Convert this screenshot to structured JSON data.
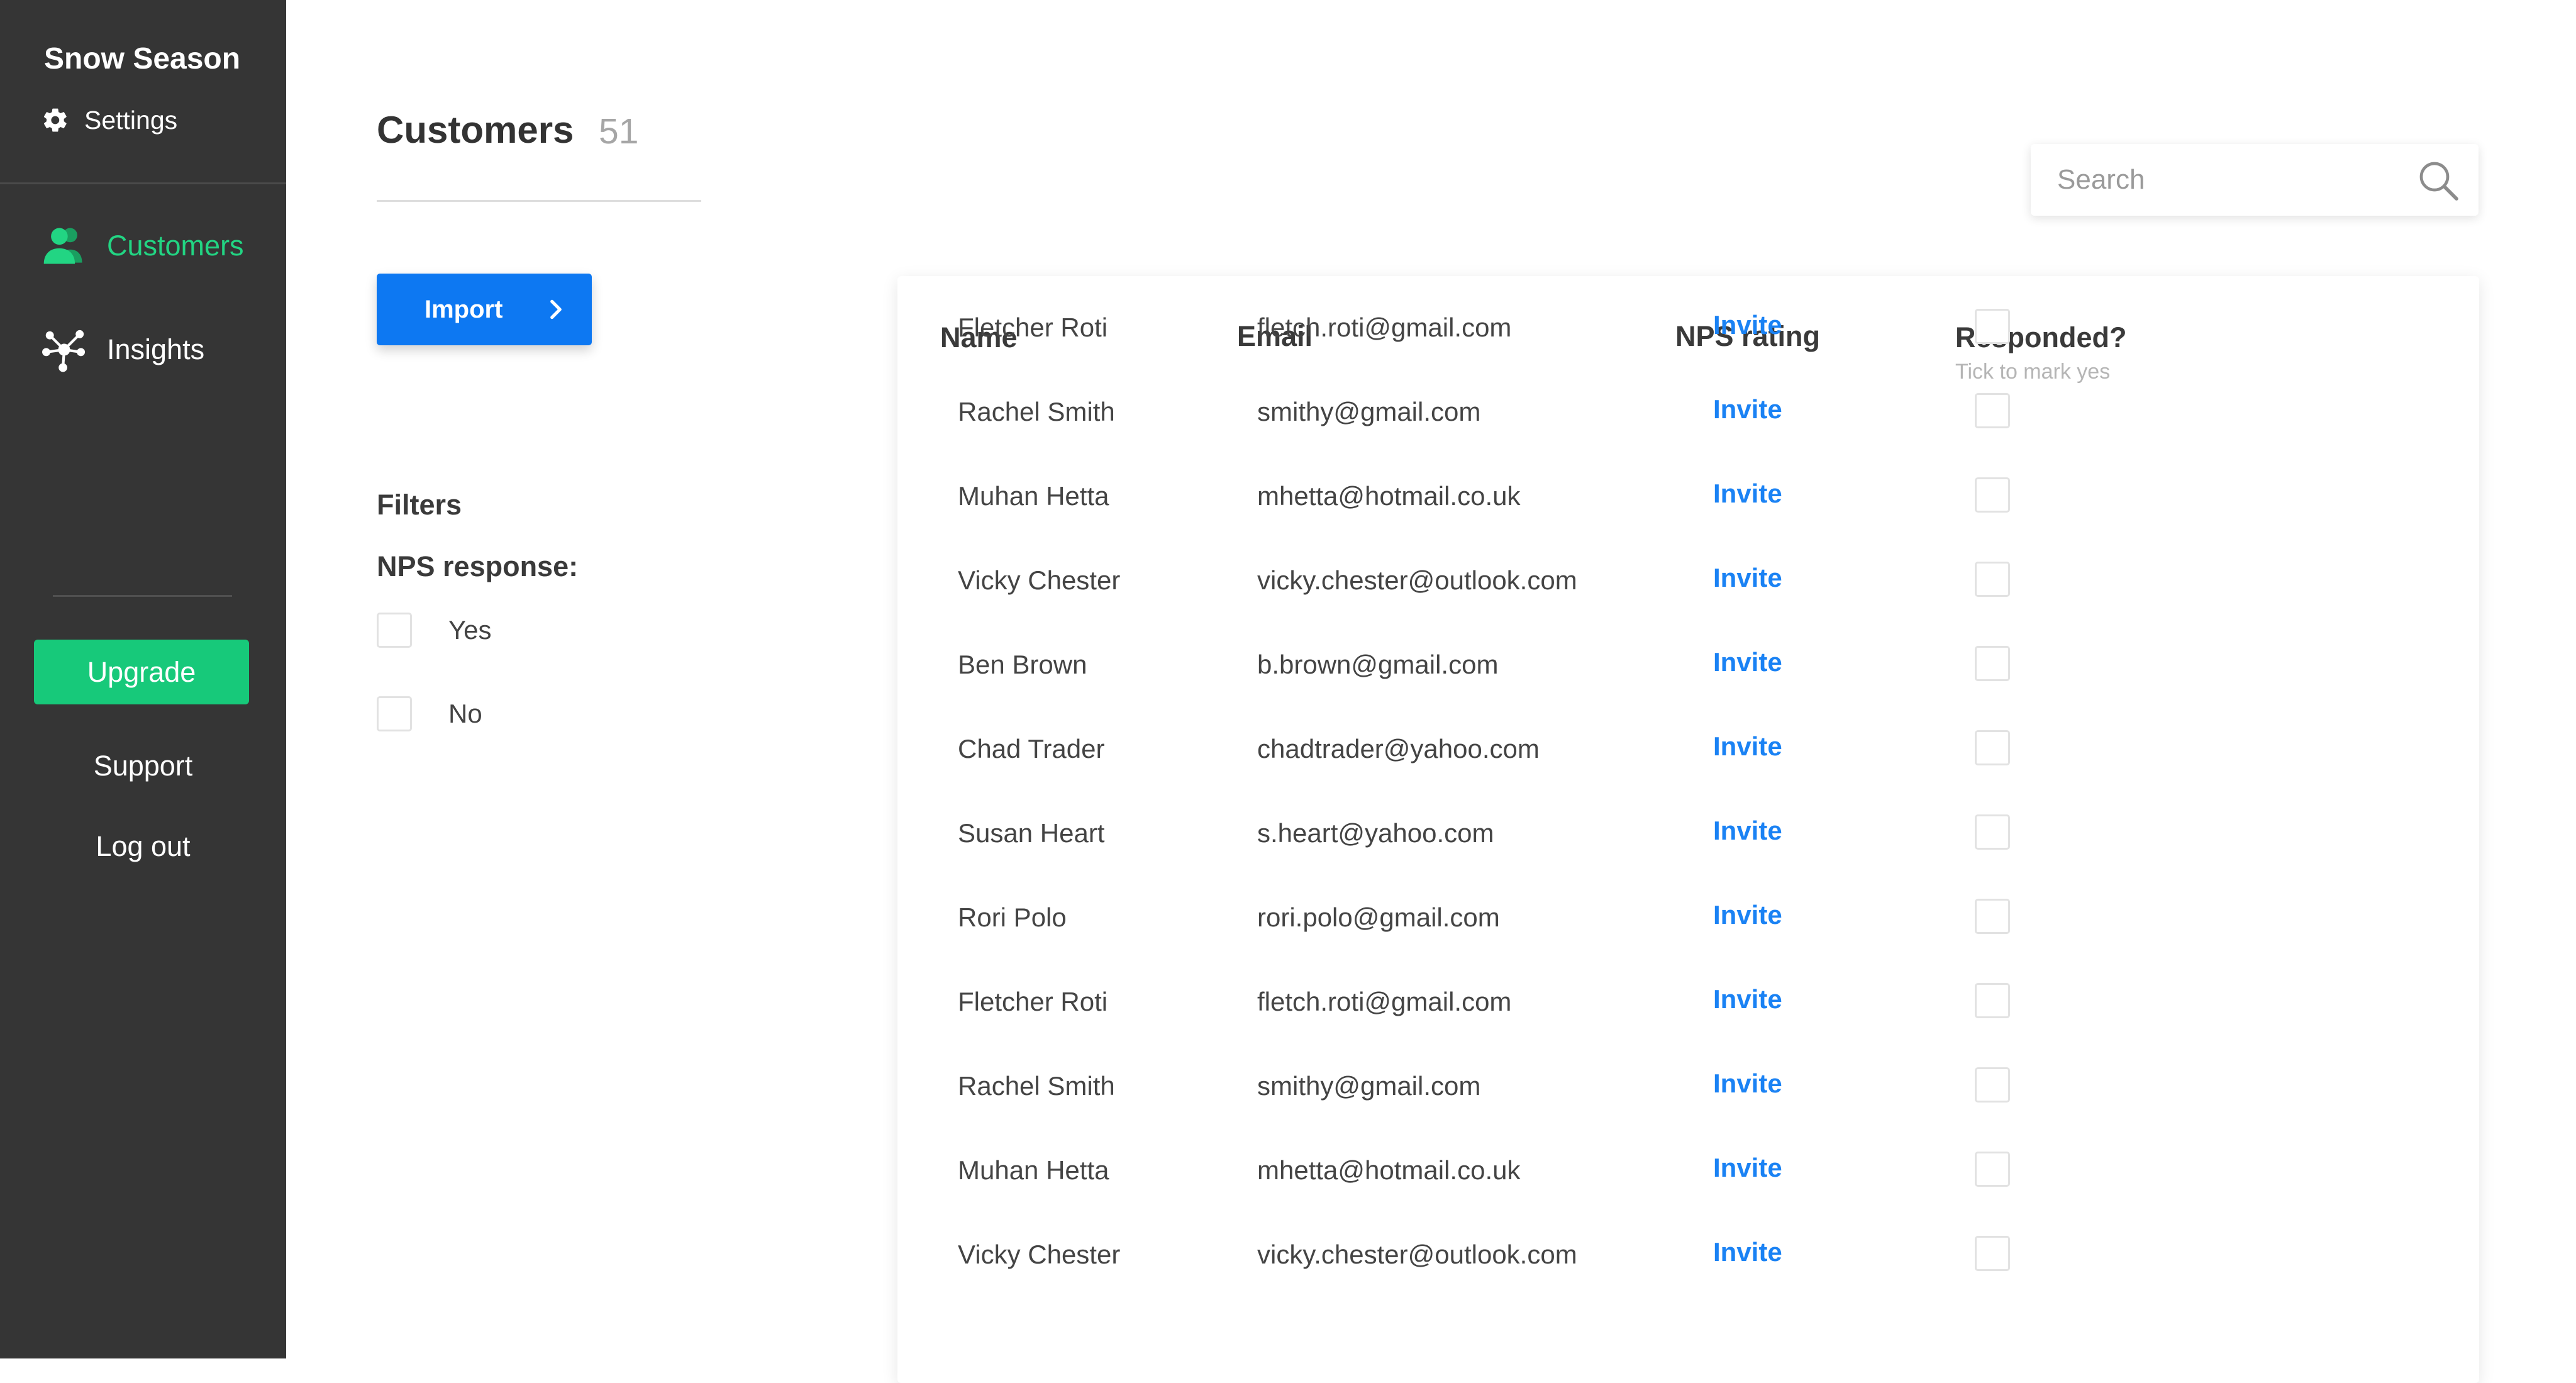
{
  "sidebar": {
    "brand": "Snow Season",
    "settings_label": "Settings",
    "nav": [
      {
        "label": "Customers",
        "icon": "users-icon",
        "active": true
      },
      {
        "label": "Insights",
        "icon": "network-icon",
        "active": false
      }
    ],
    "upgrade_label": "Upgrade",
    "support_label": "Support",
    "logout_label": "Log out"
  },
  "header": {
    "title": "Customers",
    "count": "51"
  },
  "toolbar": {
    "import_label": "Import"
  },
  "filters": {
    "title": "Filters",
    "nps_label": "NPS response:",
    "options": [
      "Yes",
      "No"
    ]
  },
  "search": {
    "placeholder": "Search"
  },
  "table": {
    "columns": {
      "name": "Name",
      "email": "Email",
      "nps": "NPS rating",
      "responded": "Responded?",
      "responded_hint": "Tick to mark yes"
    },
    "rows": [
      {
        "name": "Fletcher Roti",
        "email": "fletch.roti@gmail.com",
        "nps": "Invite"
      },
      {
        "name": "Rachel Smith",
        "email": "smithy@gmail.com",
        "nps": "Invite"
      },
      {
        "name": "Muhan Hetta",
        "email": "mhetta@hotmail.co.uk",
        "nps": "Invite"
      },
      {
        "name": "Vicky Chester",
        "email": "vicky.chester@outlook.com",
        "nps": "Invite"
      },
      {
        "name": "Ben Brown",
        "email": "b.brown@gmail.com",
        "nps": "Invite"
      },
      {
        "name": "Chad Trader",
        "email": "chadtrader@yahoo.com",
        "nps": "Invite"
      },
      {
        "name": "Susan Heart",
        "email": "s.heart@yahoo.com",
        "nps": "Invite"
      },
      {
        "name": "Rori Polo",
        "email": "rori.polo@gmail.com",
        "nps": "Invite"
      },
      {
        "name": "Fletcher Roti",
        "email": "fletch.roti@gmail.com",
        "nps": "Invite"
      },
      {
        "name": "Rachel Smith",
        "email": "smithy@gmail.com",
        "nps": "Invite"
      },
      {
        "name": "Muhan Hetta",
        "email": "mhetta@hotmail.co.uk",
        "nps": "Invite"
      },
      {
        "name": "Vicky Chester",
        "email": "vicky.chester@outlook.com",
        "nps": "Invite"
      }
    ]
  },
  "colors": {
    "sidebar_bg": "#353535",
    "accent_green": "#22d583",
    "upgrade_green": "#17c97a",
    "primary_blue": "#0d78f2",
    "link_blue": "#1a82f4"
  }
}
